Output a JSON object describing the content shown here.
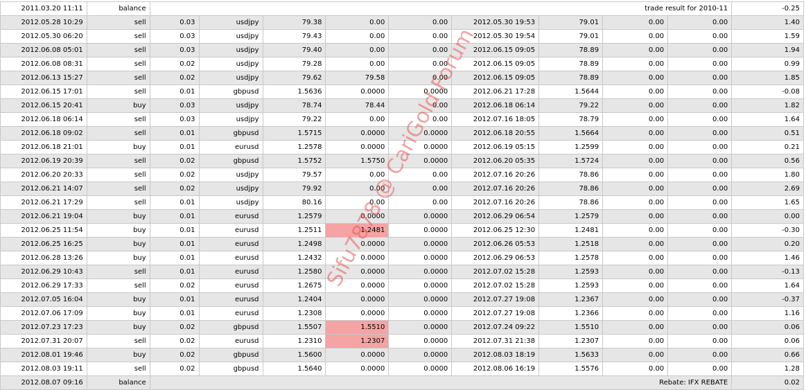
{
  "header_row": {
    "time": "2011.03.20 11:11",
    "type": "balance",
    "comment": "trade result for 2010-11",
    "profit": "-0.25"
  },
  "trades": [
    {
      "open_time": "2012.05.28 10:29",
      "type": "sell",
      "size": "0.03",
      "symbol": "usdjpy",
      "open_price": "79.38",
      "sl": "0.00",
      "tp": "0.00",
      "close_time": "2012.05.30 19:53",
      "close_price": "79.01",
      "commission": "0.00",
      "swap": "0.00",
      "profit": "1.40",
      "hl": false
    },
    {
      "open_time": "2012.05.30 06:20",
      "type": "sell",
      "size": "0.03",
      "symbol": "usdjpy",
      "open_price": "79.43",
      "sl": "0.00",
      "tp": "0.00",
      "close_time": "2012.05.30 19:54",
      "close_price": "79.01",
      "commission": "0.00",
      "swap": "0.00",
      "profit": "1.59",
      "hl": false
    },
    {
      "open_time": "2012.06.08 05:01",
      "type": "sell",
      "size": "0.03",
      "symbol": "usdjpy",
      "open_price": "79.40",
      "sl": "0.00",
      "tp": "0.00",
      "close_time": "2012.06.15 09:05",
      "close_price": "78.89",
      "commission": "0.00",
      "swap": "0.00",
      "profit": "1.94",
      "hl": false
    },
    {
      "open_time": "2012.06.08 08:31",
      "type": "sell",
      "size": "0.02",
      "symbol": "usdjpy",
      "open_price": "79.28",
      "sl": "0.00",
      "tp": "0.00",
      "close_time": "2012.06.15 09:05",
      "close_price": "78.89",
      "commission": "0.00",
      "swap": "0.00",
      "profit": "0.99",
      "hl": false
    },
    {
      "open_time": "2012.06.13 15:27",
      "type": "sell",
      "size": "0.02",
      "symbol": "usdjpy",
      "open_price": "79.62",
      "sl": "79.58",
      "tp": "0.00",
      "close_time": "2012.06.15 09:05",
      "close_price": "78.89",
      "commission": "0.00",
      "swap": "0.00",
      "profit": "1.85",
      "hl": false
    },
    {
      "open_time": "2012.06.15 17:01",
      "type": "sell",
      "size": "0.01",
      "symbol": "gbpusd",
      "open_price": "1.5636",
      "sl": "0.0000",
      "tp": "0.0000",
      "close_time": "2012.06.21 17:28",
      "close_price": "1.5644",
      "commission": "0.00",
      "swap": "0.00",
      "profit": "-0.08",
      "hl": false
    },
    {
      "open_time": "2012.06.15 20:41",
      "type": "buy",
      "size": "0.03",
      "symbol": "usdjpy",
      "open_price": "78.74",
      "sl": "78.44",
      "tp": "0.00",
      "close_time": "2012.06.18 06:14",
      "close_price": "79.22",
      "commission": "0.00",
      "swap": "0.00",
      "profit": "1.82",
      "hl": false
    },
    {
      "open_time": "2012.06.18 06:14",
      "type": "sell",
      "size": "0.03",
      "symbol": "usdjpy",
      "open_price": "79.22",
      "sl": "0.00",
      "tp": "0.00",
      "close_time": "2012.07.16 18:05",
      "close_price": "78.79",
      "commission": "0.00",
      "swap": "0.00",
      "profit": "1.64",
      "hl": false
    },
    {
      "open_time": "2012.06.18 09:02",
      "type": "sell",
      "size": "0.01",
      "symbol": "gbpusd",
      "open_price": "1.5715",
      "sl": "0.0000",
      "tp": "0.0000",
      "close_time": "2012.06.18 20:55",
      "close_price": "1.5664",
      "commission": "0.00",
      "swap": "0.00",
      "profit": "0.51",
      "hl": false
    },
    {
      "open_time": "2012.06.18 21:01",
      "type": "buy",
      "size": "0.01",
      "symbol": "eurusd",
      "open_price": "1.2578",
      "sl": "0.0000",
      "tp": "0.0000",
      "close_time": "2012.06.19 05:15",
      "close_price": "1.2599",
      "commission": "0.00",
      "swap": "0.00",
      "profit": "0.21",
      "hl": false
    },
    {
      "open_time": "2012.06.19 20:39",
      "type": "sell",
      "size": "0.02",
      "symbol": "gbpusd",
      "open_price": "1.5752",
      "sl": "1.5750",
      "tp": "0.0000",
      "close_time": "2012.06.20 05:35",
      "close_price": "1.5724",
      "commission": "0.00",
      "swap": "0.00",
      "profit": "0.56",
      "hl": false
    },
    {
      "open_time": "2012.06.20 20:33",
      "type": "sell",
      "size": "0.02",
      "symbol": "usdjpy",
      "open_price": "79.57",
      "sl": "0.00",
      "tp": "0.00",
      "close_time": "2012.07.16 20:26",
      "close_price": "78.86",
      "commission": "0.00",
      "swap": "0.00",
      "profit": "1.80",
      "hl": false
    },
    {
      "open_time": "2012.06.21 14:07",
      "type": "sell",
      "size": "0.02",
      "symbol": "usdjpy",
      "open_price": "79.92",
      "sl": "0.00",
      "tp": "0.00",
      "close_time": "2012.07.16 20:26",
      "close_price": "78.86",
      "commission": "0.00",
      "swap": "0.00",
      "profit": "2.69",
      "hl": false
    },
    {
      "open_time": "2012.06.21 17:29",
      "type": "sell",
      "size": "0.01",
      "symbol": "usdjpy",
      "open_price": "80.16",
      "sl": "0.00",
      "tp": "0.00",
      "close_time": "2012.07.16 20:26",
      "close_price": "78.86",
      "commission": "0.00",
      "swap": "0.00",
      "profit": "1.65",
      "hl": false
    },
    {
      "open_time": "2012.06.21 19:04",
      "type": "buy",
      "size": "0.01",
      "symbol": "eurusd",
      "open_price": "1.2579",
      "sl": "0.0000",
      "tp": "0.0000",
      "close_time": "2012.06.29 06:54",
      "close_price": "1.2579",
      "commission": "0.00",
      "swap": "0.00",
      "profit": "0.00",
      "hl": false
    },
    {
      "open_time": "2012.06.25 11:54",
      "type": "buy",
      "size": "0.01",
      "symbol": "eurusd",
      "open_price": "1.2511",
      "sl": "1.2481",
      "tp": "0.0000",
      "close_time": "2012.06.25 12:30",
      "close_price": "1.2481",
      "commission": "0.00",
      "swap": "0.00",
      "profit": "-0.30",
      "hl": true
    },
    {
      "open_time": "2012.06.25 16:25",
      "type": "buy",
      "size": "0.01",
      "symbol": "eurusd",
      "open_price": "1.2498",
      "sl": "0.0000",
      "tp": "0.0000",
      "close_time": "2012.06.26 05:53",
      "close_price": "1.2518",
      "commission": "0.00",
      "swap": "0.00",
      "profit": "0.20",
      "hl": false
    },
    {
      "open_time": "2012.06.28 13:26",
      "type": "buy",
      "size": "0.01",
      "symbol": "eurusd",
      "open_price": "1.2432",
      "sl": "0.0000",
      "tp": "0.0000",
      "close_time": "2012.06.29 06:53",
      "close_price": "1.2578",
      "commission": "0.00",
      "swap": "0.00",
      "profit": "1.46",
      "hl": false
    },
    {
      "open_time": "2012.06.29 10:43",
      "type": "sell",
      "size": "0.01",
      "symbol": "eurusd",
      "open_price": "1.2580",
      "sl": "0.0000",
      "tp": "0.0000",
      "close_time": "2012.07.02 15:28",
      "close_price": "1.2593",
      "commission": "0.00",
      "swap": "0.00",
      "profit": "-0.13",
      "hl": false
    },
    {
      "open_time": "2012.06.29 17:33",
      "type": "sell",
      "size": "0.02",
      "symbol": "eurusd",
      "open_price": "1.2675",
      "sl": "0.0000",
      "tp": "0.0000",
      "close_time": "2012.07.02 15:28",
      "close_price": "1.2593",
      "commission": "0.00",
      "swap": "0.00",
      "profit": "1.64",
      "hl": false
    },
    {
      "open_time": "2012.07.05 16:04",
      "type": "buy",
      "size": "0.01",
      "symbol": "eurusd",
      "open_price": "1.2404",
      "sl": "0.0000",
      "tp": "0.0000",
      "close_time": "2012.07.27 19:08",
      "close_price": "1.2367",
      "commission": "0.00",
      "swap": "0.00",
      "profit": "-0.37",
      "hl": false
    },
    {
      "open_time": "2012.07.06 17:09",
      "type": "buy",
      "size": "0.01",
      "symbol": "eurusd",
      "open_price": "1.2308",
      "sl": "0.0000",
      "tp": "0.0000",
      "close_time": "2012.07.27 19:08",
      "close_price": "1.2366",
      "commission": "0.00",
      "swap": "0.00",
      "profit": "1.16",
      "hl": false
    },
    {
      "open_time": "2012.07.23 17:23",
      "type": "buy",
      "size": "0.02",
      "symbol": "gbpusd",
      "open_price": "1.5507",
      "sl": "1.5510",
      "tp": "0.0000",
      "close_time": "2012.07.24 09:22",
      "close_price": "1.5510",
      "commission": "0.00",
      "swap": "0.00",
      "profit": "0.06",
      "hl": true
    },
    {
      "open_time": "2012.07.31 20:07",
      "type": "sell",
      "size": "0.02",
      "symbol": "eurusd",
      "open_price": "1.2310",
      "sl": "1.2307",
      "tp": "0.0000",
      "close_time": "2012.07.31 21:38",
      "close_price": "1.2307",
      "commission": "0.00",
      "swap": "0.00",
      "profit": "0.06",
      "hl": true
    },
    {
      "open_time": "2012.08.01 19:46",
      "type": "buy",
      "size": "0.02",
      "symbol": "gbpusd",
      "open_price": "1.5600",
      "sl": "0.0000",
      "tp": "0.0000",
      "close_time": "2012.08.03 18:19",
      "close_price": "1.5633",
      "commission": "0.00",
      "swap": "0.00",
      "profit": "0.66",
      "hl": false
    },
    {
      "open_time": "2012.08.03 19:11",
      "type": "sell",
      "size": "0.02",
      "symbol": "gbpusd",
      "open_price": "1.5640",
      "sl": "0.0000",
      "tp": "0.0000",
      "close_time": "2012.08.06 16:19",
      "close_price": "1.5576",
      "commission": "0.00",
      "swap": "0.00",
      "profit": "1.28",
      "hl": false
    }
  ],
  "footer_row": {
    "time": "2012.08.07 09:16",
    "type": "balance",
    "comment": "Rebate: IFX REBATE",
    "profit": "0.02"
  },
  "watermark": "Sifu7878 @ CariGold Forum",
  "colors": {
    "shade": "#e6e6e6",
    "highlight": "#f5a3a3",
    "watermark": "#e65a5a"
  }
}
